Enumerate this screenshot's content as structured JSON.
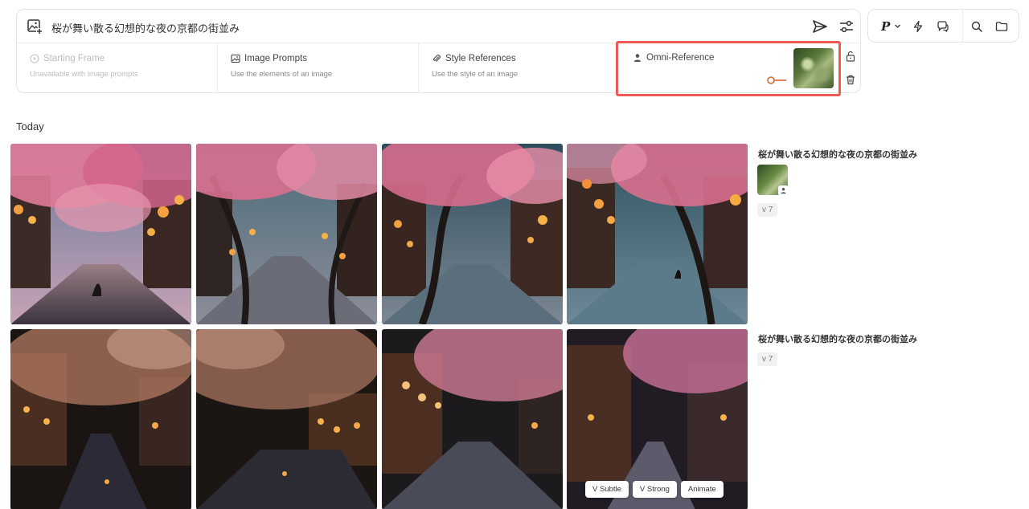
{
  "prompt": {
    "text": "桜が舞い散る幻想的な夜の京都の街並み",
    "add_image_icon": "image-plus-icon",
    "send_icon": "send-icon",
    "settings_icon": "sliders-icon"
  },
  "references": [
    {
      "title": "Starting Frame",
      "subtitle": "Unavailable with image prompts",
      "icon": "play-circle-icon",
      "disabled": true
    },
    {
      "title": "Image Prompts",
      "subtitle": "Use the elements of an image",
      "icon": "image-icon",
      "disabled": false
    },
    {
      "title": "Style References",
      "subtitle": "Use the style of an image",
      "icon": "paperclip-icon",
      "disabled": false
    },
    {
      "title": "Omni-Reference",
      "icon": "person-icon",
      "disabled": false
    }
  ],
  "toolbar": {
    "version_label": "P",
    "items": [
      "version-dropdown",
      "bolt-icon",
      "chat-icon",
      "search-icon",
      "folder-icon"
    ]
  },
  "gallery": {
    "section_title": "Today",
    "groups": [
      {
        "prompt": "桜が舞い散る幻想的な夜の京都の街並み",
        "version": "v 7",
        "has_omni_reference": true
      },
      {
        "prompt": "桜が舞い散る幻想的な夜の京都の街並み",
        "version": "v 7",
        "has_omni_reference": false
      }
    ],
    "hover_actions": [
      "V Subtle",
      "V Strong",
      "Animate"
    ]
  },
  "colors": {
    "highlight_border": "#ee5a55",
    "slider_accent": "#e0642f"
  }
}
